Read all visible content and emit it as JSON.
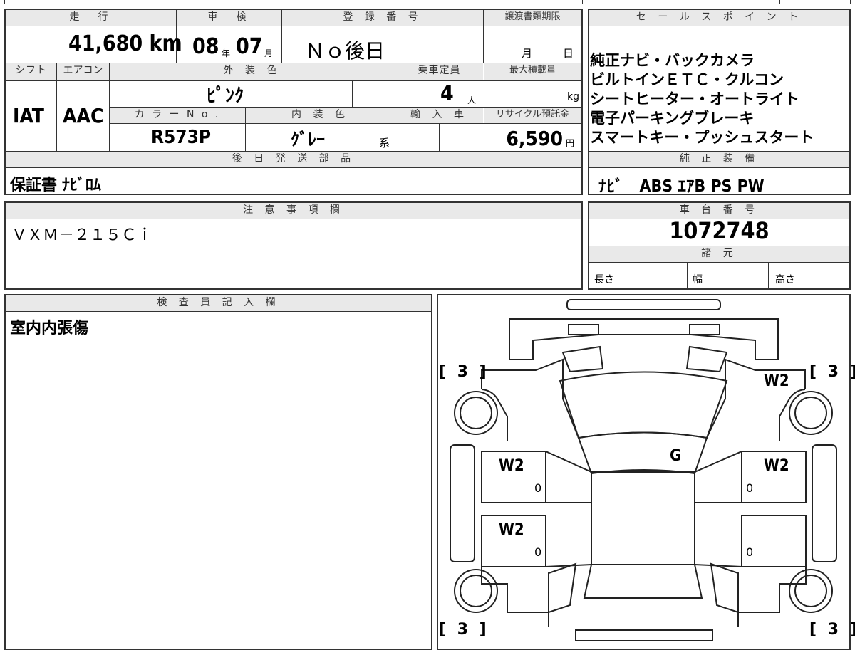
{
  "top_panel": {
    "headers": {
      "mileage": "走　行",
      "inspection": "車　検",
      "registration": "登 録 番 号",
      "transfer_deadline": "譲渡書類期限",
      "shift": "シフト",
      "aircon": "エアコン",
      "exterior_color": "外 装 色",
      "capacity": "乗車定員",
      "max_load": "最大積載量",
      "color_no": "カ ラ ー N o .",
      "interior_color": "内 装 色",
      "import": "輸 入 車",
      "recycle_fee": "リサイクル預託金",
      "later_parts": "後 日 発 送 部 品"
    },
    "mileage_value": "41,680 km",
    "inspection_year": "08",
    "inspection_year_unit": "年",
    "inspection_month": "07",
    "inspection_month_unit": "月",
    "registration_value": "Ｎｏ後日",
    "transfer_month_label": "月",
    "transfer_day_label": "日",
    "shift_value": "IAT",
    "aircon_value": "AAC",
    "exterior_color_value": "ﾋﾟﾝｸ",
    "capacity_value": "4",
    "capacity_unit": "人",
    "max_load_unit": "kg",
    "color_no_value": "R573P",
    "interior_color_value": "ｸﾞﾚｰ",
    "interior_color_suffix": "系",
    "recycle_value": "6,590",
    "recycle_unit": "円",
    "later_parts_value": "保証書 ﾅﾋﾞﾛﾑ"
  },
  "sales_points": {
    "header": "セ ー ル ス ポ イ ン ト",
    "lines": [
      "純正ナビ・バックカメラ",
      "ビルトインＥＴＣ・クルコン",
      "シートヒーター・オートライト",
      "電子パーキングブレーキ",
      "スマートキー・プッシュスタート"
    ]
  },
  "genuine_equipment": {
    "header": "純 正 装 備",
    "value": "ﾅﾋﾞ　ABS ｴｱB PS PW"
  },
  "notes": {
    "header": "注 意 事 項 欄",
    "value": "ＶＸＭ－２１５Ｃｉ"
  },
  "chassis": {
    "header": "車 台 番 号",
    "value": "1072748",
    "specs_header": "諸 元",
    "length_label": "長さ",
    "width_label": "幅",
    "height_label": "高さ"
  },
  "inspector": {
    "header": "検 査 員 記 入 欄",
    "value": "室内内張傷"
  },
  "diagram": {
    "tire_tl": "[ 3 ]",
    "tire_tr": "[ 3 ]",
    "tire_bl": "[ 3 ]",
    "tire_br": "[ 3 ]",
    "front_right_panel": "W2",
    "windshield": "G",
    "left_front_door": "W2",
    "left_rear_door": "W2",
    "right_front_door": "W2",
    "zero_1": "0",
    "zero_2": "0",
    "zero_3": "0",
    "zero_4": "0"
  }
}
